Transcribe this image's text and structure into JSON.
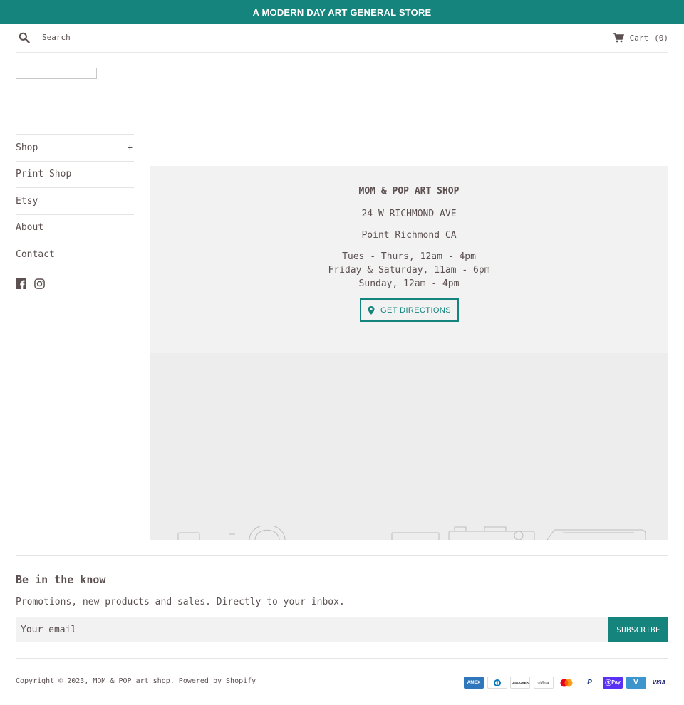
{
  "announcement": {
    "text": "A MODERN DAY ART GENERAL STORE"
  },
  "header": {
    "search_placeholder": "Search",
    "cart_label": "Cart",
    "cart_count": "(0)"
  },
  "nav": {
    "items": [
      {
        "label": "Shop",
        "expand": "+"
      },
      {
        "label": "Print Shop"
      },
      {
        "label": "Etsy"
      },
      {
        "label": "About"
      },
      {
        "label": "Contact"
      }
    ]
  },
  "social": {
    "icons": [
      "facebook-icon",
      "instagram-icon"
    ]
  },
  "store": {
    "name": "MOM & POP ART SHOP",
    "address": "24 W RICHMOND AVE",
    "city": "Point Richmond CA",
    "hours": [
      "Tues - Thurs, 12am - 4pm",
      "Friday & Saturday, 11am - 6pm",
      "Sunday, 12am - 4pm"
    ],
    "directions_label": "GET DIRECTIONS"
  },
  "newsletter": {
    "title": "Be in the know",
    "text": "Promotions, new products and sales. Directly to your inbox.",
    "email_placeholder": "Your email",
    "subscribe_label": "SUBSCRIBE"
  },
  "footer": {
    "copyright_prefix": "Copyright © 2023, ",
    "shop_link": "MOM & POP art shop",
    "separator": ". ",
    "powered": "Powered by Shopify",
    "payments": [
      {
        "name": "American Express",
        "label": "AMEX",
        "bg": "#2e77bc"
      },
      {
        "name": "Diners Club",
        "label": "◐",
        "bg": "#ffffff"
      },
      {
        "name": "Discover",
        "label": "DISCOVER",
        "bg": "#ffffff"
      },
      {
        "name": "Meta Pay",
        "label": "∞Meta",
        "bg": "#ffffff"
      },
      {
        "name": "Mastercard",
        "label": "",
        "bg": "#ffffff"
      },
      {
        "name": "PayPal",
        "label": "P",
        "bg": "#ffffff"
      },
      {
        "name": "Shop Pay",
        "label": "Pay",
        "bg": "#5a31f4"
      },
      {
        "name": "Venmo",
        "label": "V",
        "bg": "#3d95ce"
      },
      {
        "name": "Visa",
        "label": "VISA",
        "bg": "#ffffff"
      }
    ]
  },
  "colors": {
    "accent": "#14847c",
    "text": "#5c5050",
    "panel": "#f2f2f2"
  }
}
